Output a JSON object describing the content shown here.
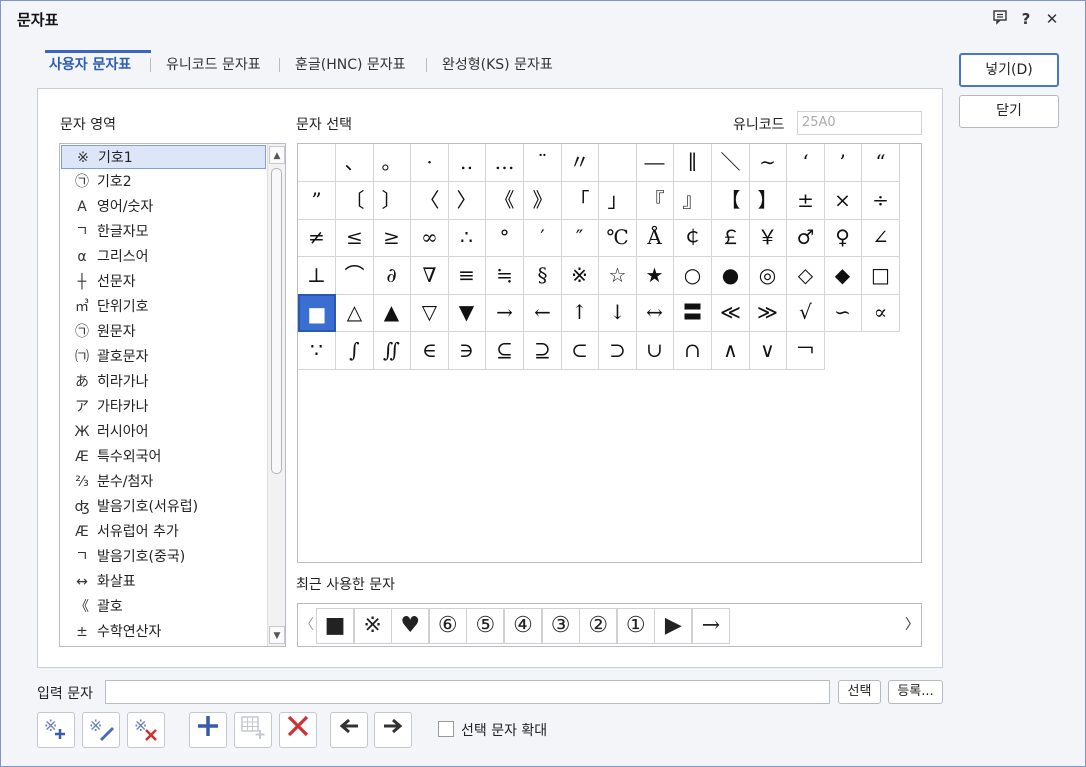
{
  "window": {
    "title": "문자표"
  },
  "tabs": [
    "사용자 문자표",
    "유니코드 문자표",
    "훈글(HNC) 문자표",
    "완성형(KS) 문자표"
  ],
  "labels": {
    "area": "문자 영역",
    "select": "문자 선택",
    "unicode": "유니코드",
    "recent": "최근 사용한 문자",
    "input": "입력 문자",
    "enlarge": "선택 문자 확대"
  },
  "unicode_value": "25A0",
  "buttons": {
    "insert": "넣기(D)",
    "close": "닫기",
    "select": "선택",
    "register": "등록..."
  },
  "areas": [
    {
      "glyph": "※",
      "label": "기호1"
    },
    {
      "glyph": "㉠",
      "label": "기호2"
    },
    {
      "glyph": "A",
      "label": "영어/숫자"
    },
    {
      "glyph": "ㄱ",
      "label": "한글자모"
    },
    {
      "glyph": "α",
      "label": "그리스어"
    },
    {
      "glyph": "┼",
      "label": "선문자"
    },
    {
      "glyph": "㎥",
      "label": "단위기호"
    },
    {
      "glyph": "㉠",
      "label": "원문자"
    },
    {
      "glyph": "㈀",
      "label": "괄호문자"
    },
    {
      "glyph": "あ",
      "label": "히라가나"
    },
    {
      "glyph": "ア",
      "label": "가타카나"
    },
    {
      "glyph": "Ж",
      "label": "러시아어"
    },
    {
      "glyph": "Æ",
      "label": "특수외국어"
    },
    {
      "glyph": "⅔",
      "label": "분수/첨자"
    },
    {
      "glyph": "ʤ",
      "label": "발음기호(서유럽)"
    },
    {
      "glyph": "Æ",
      "label": "서유럽어 추가"
    },
    {
      "glyph": "ㄱ",
      "label": "발음기호(중국)"
    },
    {
      "glyph": "↔",
      "label": "화살표"
    },
    {
      "glyph": "《",
      "label": "괄호"
    },
    {
      "glyph": "±",
      "label": "수학연산자"
    }
  ],
  "symbols": [
    "",
    "、",
    "。",
    "·",
    "‥",
    "…",
    "¨",
    "〃",
    "­",
    "―",
    "∥",
    "＼",
    "∼",
    "‘",
    "’",
    "“",
    "”",
    "〔",
    "〕",
    "〈",
    "〉",
    "《",
    "》",
    "「",
    "」",
    "『",
    "』",
    "【",
    "】",
    "±",
    "×",
    "÷",
    "≠",
    "≤",
    "≥",
    "∞",
    "∴",
    "°",
    "′",
    "″",
    "℃",
    "Å",
    "￠",
    "￡",
    "￥",
    "♂",
    "♀",
    "∠",
    "⊥",
    "⌒",
    "∂",
    "∇",
    "≡",
    "≒",
    "§",
    "※",
    "☆",
    "★",
    "○",
    "●",
    "◎",
    "◇",
    "◆",
    "□",
    "■",
    "△",
    "▲",
    "▽",
    "▼",
    "→",
    "←",
    "↑",
    "↓",
    "↔",
    "〓",
    "≪",
    "≫",
    "√",
    "∽",
    "∝",
    "∵",
    "∫",
    "∬",
    "∈",
    "∋",
    "⊆",
    "⊇",
    "⊂",
    "⊃",
    "∪",
    "∩",
    "∧",
    "∨",
    "￢"
  ],
  "selected_index": 64,
  "recent": [
    "■",
    "※",
    "♥",
    "⑥",
    "⑤",
    "④",
    "③",
    "②",
    "①",
    "▶",
    "→"
  ],
  "colors": {
    "accent": "#2a5cb8",
    "selected": "#3a6ed0"
  }
}
